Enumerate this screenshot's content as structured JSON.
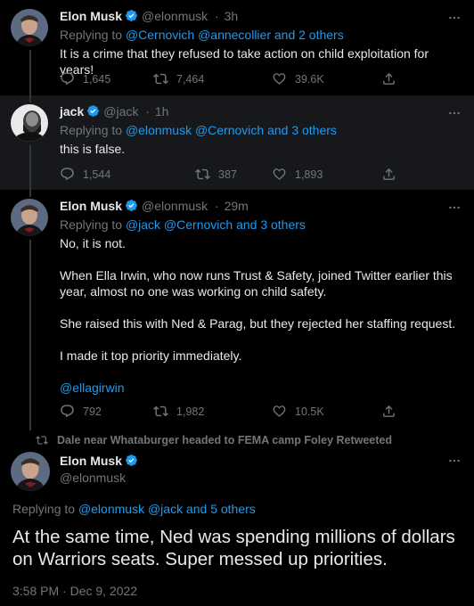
{
  "tweets": [
    {
      "name": "Elon Musk",
      "handle": "@elonmusk",
      "sep": "·",
      "time": "3h",
      "replying_prefix": "Replying to",
      "replying_links": "@Cernovich @annecollier and 2 others",
      "body": [
        "It is a crime that they refused to take action on child exploitation for years!"
      ],
      "replies": "1,645",
      "retweets": "7,464",
      "likes": "39.6K"
    },
    {
      "name": "jack",
      "handle": "@jack",
      "sep": "·",
      "time": "1h",
      "replying_prefix": "Replying to",
      "replying_links": "@elonmusk @Cernovich and 3 others",
      "body": [
        "this is false."
      ],
      "replies": "1,544",
      "retweets": "387",
      "likes": "1,893"
    },
    {
      "name": "Elon Musk",
      "handle": "@elonmusk",
      "sep": "·",
      "time": "29m",
      "replying_prefix": "Replying to",
      "replying_links": "@jack @Cernovich and 3 others",
      "body": [
        "No, it is not.",
        "When Ella Irwin, who now runs Trust & Safety, joined Twitter earlier this year, almost no one was working on child safety.",
        "She raised this with Ned & Parag, but they rejected her staffing request.",
        "I made it top priority immediately."
      ],
      "mention": "@ellagirwin",
      "replies": "792",
      "retweets": "1,982",
      "likes": "10.5K"
    }
  ],
  "main": {
    "retweeted_by": "Dale near Whataburger headed to FEMA camp Foley Retweeted",
    "name": "Elon Musk",
    "handle": "@elonmusk",
    "replying_prefix": "Replying to",
    "replying_links": "@elonmusk @jack and 5 others",
    "body": "At the same time, Ned was spending millions of dollars on Warriors seats. Super messed up priorities.",
    "timestamp": "3:58 PM · Dec 9, 2022"
  },
  "icons": {
    "verified": "verified-badge-icon",
    "reply": "reply-icon",
    "retweet": "retweet-icon",
    "like": "heart-icon",
    "share": "share-icon",
    "more": "more-icon"
  },
  "colors": {
    "link": "#1d9bf0",
    "verified": "#1d9bf0",
    "muted": "#71767b",
    "text": "#e7e9ea"
  }
}
